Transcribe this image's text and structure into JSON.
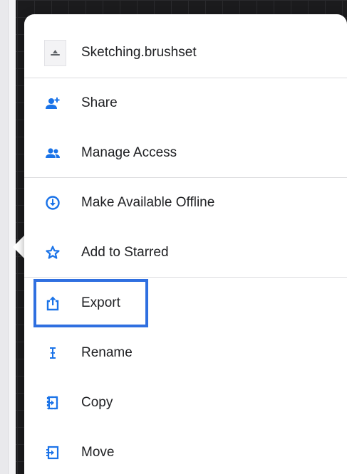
{
  "header": {
    "file_name": "Sketching.brushset",
    "file_icon": "brushset-file-icon"
  },
  "menu": {
    "items": [
      {
        "label": "Share",
        "icon": "person-add-icon"
      },
      {
        "label": "Manage Access",
        "icon": "people-icon"
      },
      {
        "label": "Make Available Offline",
        "icon": "offline-download-icon"
      },
      {
        "label": "Add to Starred",
        "icon": "star-icon"
      },
      {
        "label": "Export",
        "icon": "export-icon"
      },
      {
        "label": "Rename",
        "icon": "text-cursor-icon"
      },
      {
        "label": "Copy",
        "icon": "copy-icon"
      },
      {
        "label": "Move",
        "icon": "move-icon"
      }
    ],
    "highlighted_item": "Export"
  },
  "colors": {
    "accent": "#1a73e8",
    "highlight_border": "#2f6fe0",
    "text": "#202124",
    "divider": "#dcdcdf"
  }
}
